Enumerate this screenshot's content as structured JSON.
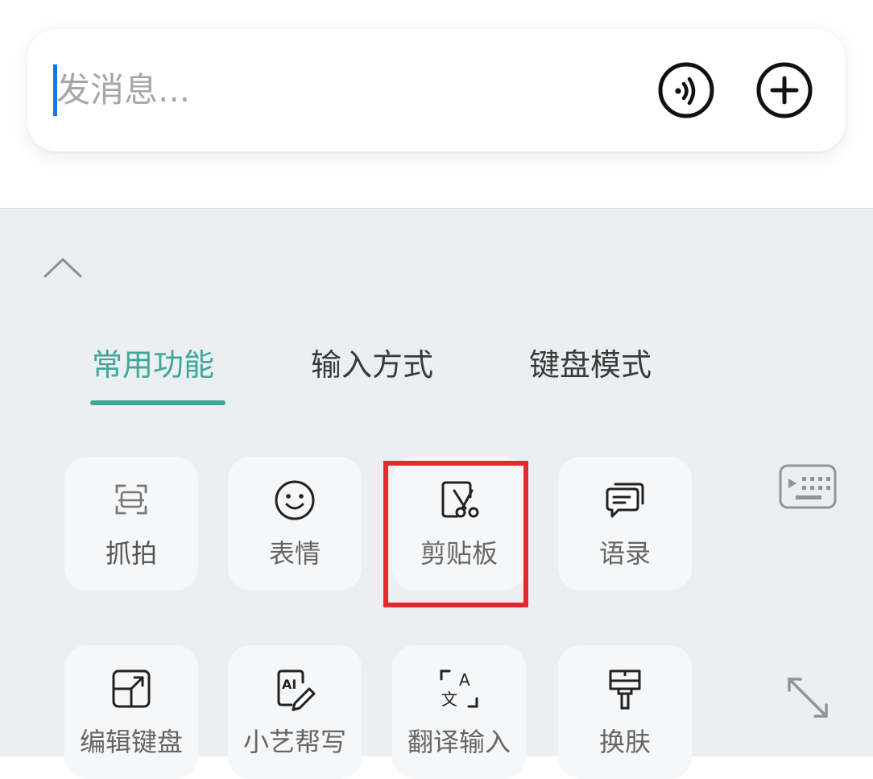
{
  "input": {
    "placeholder": "发消息..."
  },
  "icons": {
    "voice": "voice-icon",
    "add": "plus-circle-icon",
    "collapse": "chevron-up-icon",
    "keyboard": "keyboard-icon",
    "expand": "expand-arrows-icon"
  },
  "tabs": [
    {
      "label": "常用功能",
      "active": true
    },
    {
      "label": "输入方式",
      "active": false
    },
    {
      "label": "键盘模式",
      "active": false
    }
  ],
  "functions": [
    {
      "label": "抓拍",
      "icon": "scan-camera-icon"
    },
    {
      "label": "表情",
      "icon": "smiley-icon"
    },
    {
      "label": "剪贴板",
      "icon": "clipboard-scissors-icon",
      "highlighted": true
    },
    {
      "label": "语录",
      "icon": "chat-bubbles-icon"
    },
    {
      "label": "编辑键盘",
      "icon": "edit-keyboard-icon"
    },
    {
      "label": "小艺帮写",
      "icon": "ai-write-icon"
    },
    {
      "label": "翻译输入",
      "icon": "translate-icon"
    },
    {
      "label": "换肤",
      "icon": "paint-brush-icon"
    }
  ],
  "colors": {
    "accent": "#3fa79b",
    "caret": "#1a73e8",
    "highlight": "#e8262e",
    "panel_bg": "#eceff1"
  }
}
